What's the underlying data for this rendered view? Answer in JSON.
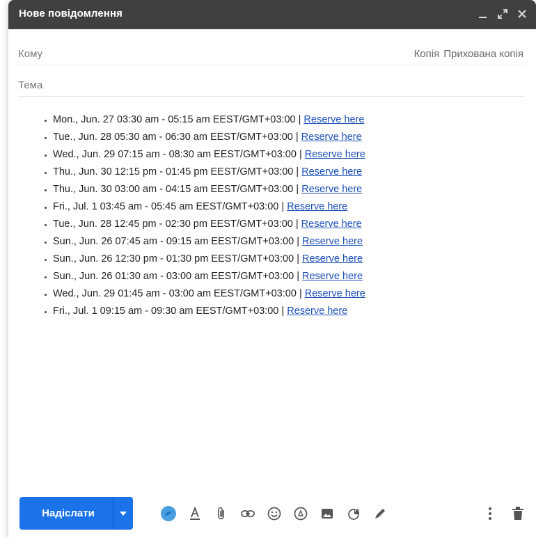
{
  "window": {
    "title": "Нове повідомлення"
  },
  "to": {
    "label": "Кому",
    "value": "",
    "cc_label": "Копія",
    "bcc_label": "Прихована копія"
  },
  "subject": {
    "label": "Тема",
    "value": ""
  },
  "body": {
    "link_text": "Reserve here",
    "items": [
      {
        "text": "Mon., Jun. 27 03:30 am - 05:15 am EEST/GMT+03:00 | ",
        "link": "Reserve here"
      },
      {
        "text": "Tue., Jun. 28 05:30 am - 06:30 am EEST/GMT+03:00 | ",
        "link": "Reserve here"
      },
      {
        "text": "Wed., Jun. 29 07:15 am - 08:30 am EEST/GMT+03:00 | ",
        "link": "Reserve here"
      },
      {
        "text": "Thu., Jun. 30 12:15 pm - 01:45 pm EEST/GMT+03:00 | ",
        "link": "Reserve here"
      },
      {
        "text": "Thu., Jun. 30 03:00 am - 04:15 am EEST/GMT+03:00 | ",
        "link": "Reserve here"
      },
      {
        "text": "Fri., Jul. 1 03:45 am - 05:45 am EEST/GMT+03:00 | ",
        "link": "Reserve here"
      },
      {
        "text": "Tue., Jun. 28 12:45 pm - 02:30 pm EEST/GMT+03:00 | ",
        "link": "Reserve here"
      },
      {
        "text": "Sun., Jun. 26 07:45 am - 09:15 am EEST/GMT+03:00 | ",
        "link": "Reserve here"
      },
      {
        "text": "Sun., Jun. 26 12:30 pm - 01:30 pm EEST/GMT+03:00 | ",
        "link": "Reserve here"
      },
      {
        "text": "Sun., Jun. 26 01:30 am - 03:00 am EEST/GMT+03:00 | ",
        "link": "Reserve here"
      },
      {
        "text": "Wed., Jun. 29 01:45 am - 03:00 am EEST/GMT+03:00 | ",
        "link": "Reserve here"
      },
      {
        "text": "Fri., Jul. 1 09:15 am - 09:30 am EEST/GMT+03:00 | ",
        "link": "Reserve here"
      }
    ]
  },
  "toolbar": {
    "send_label": "Надіслати",
    "icons": [
      "formatting-options-icon",
      "text-color-icon",
      "attach-file-icon",
      "insert-link-icon",
      "emoji-icon",
      "google-drive-icon",
      "insert-photo-icon",
      "confidential-mode-icon",
      "signature-icon"
    ],
    "right_icons": [
      "more-options-icon",
      "discard-draft-icon"
    ]
  },
  "colors": {
    "titlebar": "#404040",
    "send_button": "#1a73e8",
    "link": "#1a4fb8",
    "formatting_icon_accent": "#4a9fe0"
  }
}
